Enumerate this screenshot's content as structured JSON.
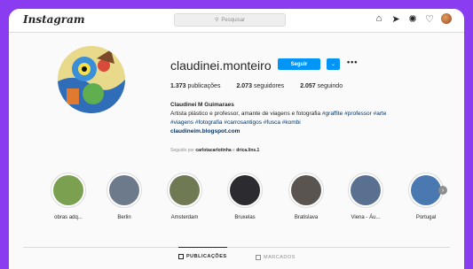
{
  "header": {
    "logo": "Instagram",
    "search_placeholder": "Pesquisar",
    "icons": [
      "home-icon",
      "direct-icon",
      "explore-icon",
      "heart-icon",
      "profile-avatar"
    ]
  },
  "profile": {
    "username": "claudinei.monteiro",
    "follow_label": "Seguir",
    "stats": {
      "posts_count": "1.373",
      "posts_label": "publicações",
      "followers_count": "2.073",
      "followers_label": "seguidores",
      "following_count": "2.057",
      "following_label": "seguindo"
    },
    "full_name": "Claudinei M Guimaraes",
    "bio_text": "Artista plástico e professor, amante de viagens e fotografia",
    "bio_tags_1": "#graffite #professor #arte",
    "bio_tags_2": "#viagens #fotografia #carrosantigos #fusca #kombi",
    "website": "claudineim.blogspot.com",
    "followed_by_prefix": "Seguido por",
    "followed_by_1": "carlotacarlotinha",
    "followed_by_sep": "e",
    "followed_by_2": "drica.lins.1"
  },
  "highlights": [
    {
      "label": "obras adq...",
      "color": "#7aa050"
    },
    {
      "label": "Berlin",
      "color": "#6d7a8c"
    },
    {
      "label": "Amsterdam",
      "color": "#6f7a55"
    },
    {
      "label": "Bruxelas",
      "color": "#2b2b30"
    },
    {
      "label": "Bratislava",
      "color": "#5a5450"
    },
    {
      "label": "Viena - Áu...",
      "color": "#5a7090"
    },
    {
      "label": "Portugal",
      "color": "#4a78b0"
    }
  ],
  "tabs": [
    {
      "label": "PUBLICAÇÕES",
      "active": true
    },
    {
      "label": "MARCADOS",
      "active": false
    }
  ]
}
